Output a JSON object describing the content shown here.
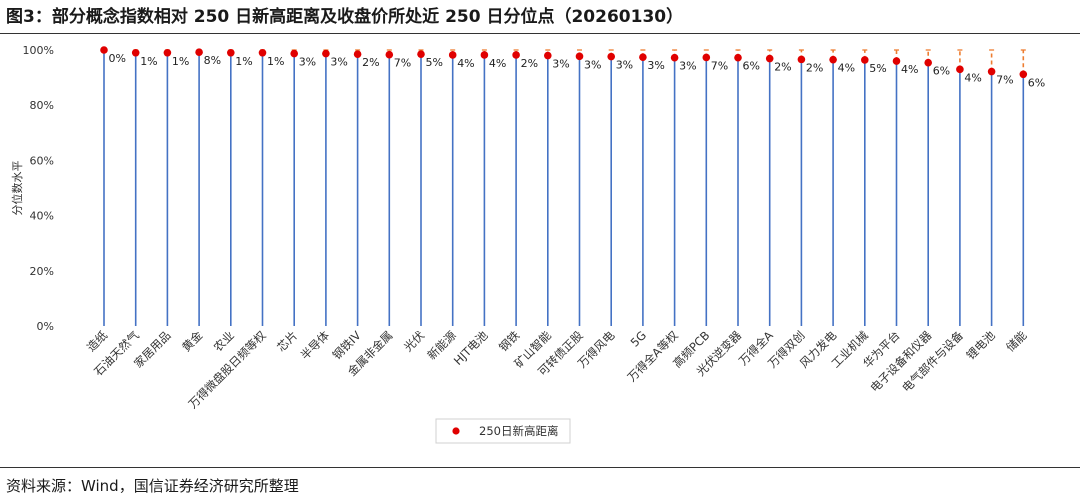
{
  "header": {
    "title": "图3：部分概念指数相对 250 日新高距离及收盘价所处近 250 日分位点（20260130）"
  },
  "footer": {
    "source": "资料来源：Wind，国信证券经济研究所整理"
  },
  "colors": {
    "stem": "#4472C4",
    "dot": "#E00000",
    "dash": "#ED7D31",
    "text": "#333333"
  },
  "chart_data": {
    "type": "scatter",
    "title": "",
    "ylabel": "分位数水平",
    "ylim": [
      0,
      1
    ],
    "ytick_labels": [
      "0%",
      "20%",
      "40%",
      "60%",
      "80%",
      "100%"
    ],
    "grid": false,
    "legend": {
      "position": "bottom-center",
      "entries": [
        "250日新高距离"
      ]
    },
    "categories": [
      "造纸",
      "石油天然气",
      "家居用品",
      "黄金",
      "农业",
      "万得微盘股日频等权",
      "芯片",
      "半导体",
      "钢铁IV",
      "金属非金属",
      "光伏",
      "新能源",
      "HJT电池",
      "钢铁",
      "矿山智能",
      "可转债正股",
      "万得风电",
      "5G",
      "万得全A等权",
      "高频PCB",
      "光伏逆变器",
      "万得全A",
      "万得双创",
      "风力发电",
      "工业机械",
      "华为平台",
      "电子设备和仪器",
      "电气部件与设备",
      "锂电池",
      "储能"
    ],
    "series": [
      {
        "name": "250日新高距离",
        "values": [
          0.0,
          0.01,
          0.01,
          0.008,
          0.01,
          0.01,
          0.013,
          0.013,
          0.015,
          0.017,
          0.015,
          0.018,
          0.018,
          0.018,
          0.02,
          0.023,
          0.024,
          0.026,
          0.028,
          0.027,
          0.028,
          0.031,
          0.034,
          0.035,
          0.036,
          0.04,
          0.046,
          0.07,
          0.078,
          0.088
        ],
        "data_labels": [
          "0%",
          "1%",
          "1%",
          "8%",
          "1%",
          "1%",
          "3%",
          "3%",
          "2%",
          "7%",
          "5%",
          "4%",
          "4%",
          "2%",
          "3%",
          "3%",
          "3%",
          "3%",
          "3%",
          "7%",
          "6%",
          "2%",
          "2%",
          "4%",
          "5%",
          "4%",
          "6%",
          "4%",
          "7%",
          "6%"
        ]
      }
    ]
  }
}
